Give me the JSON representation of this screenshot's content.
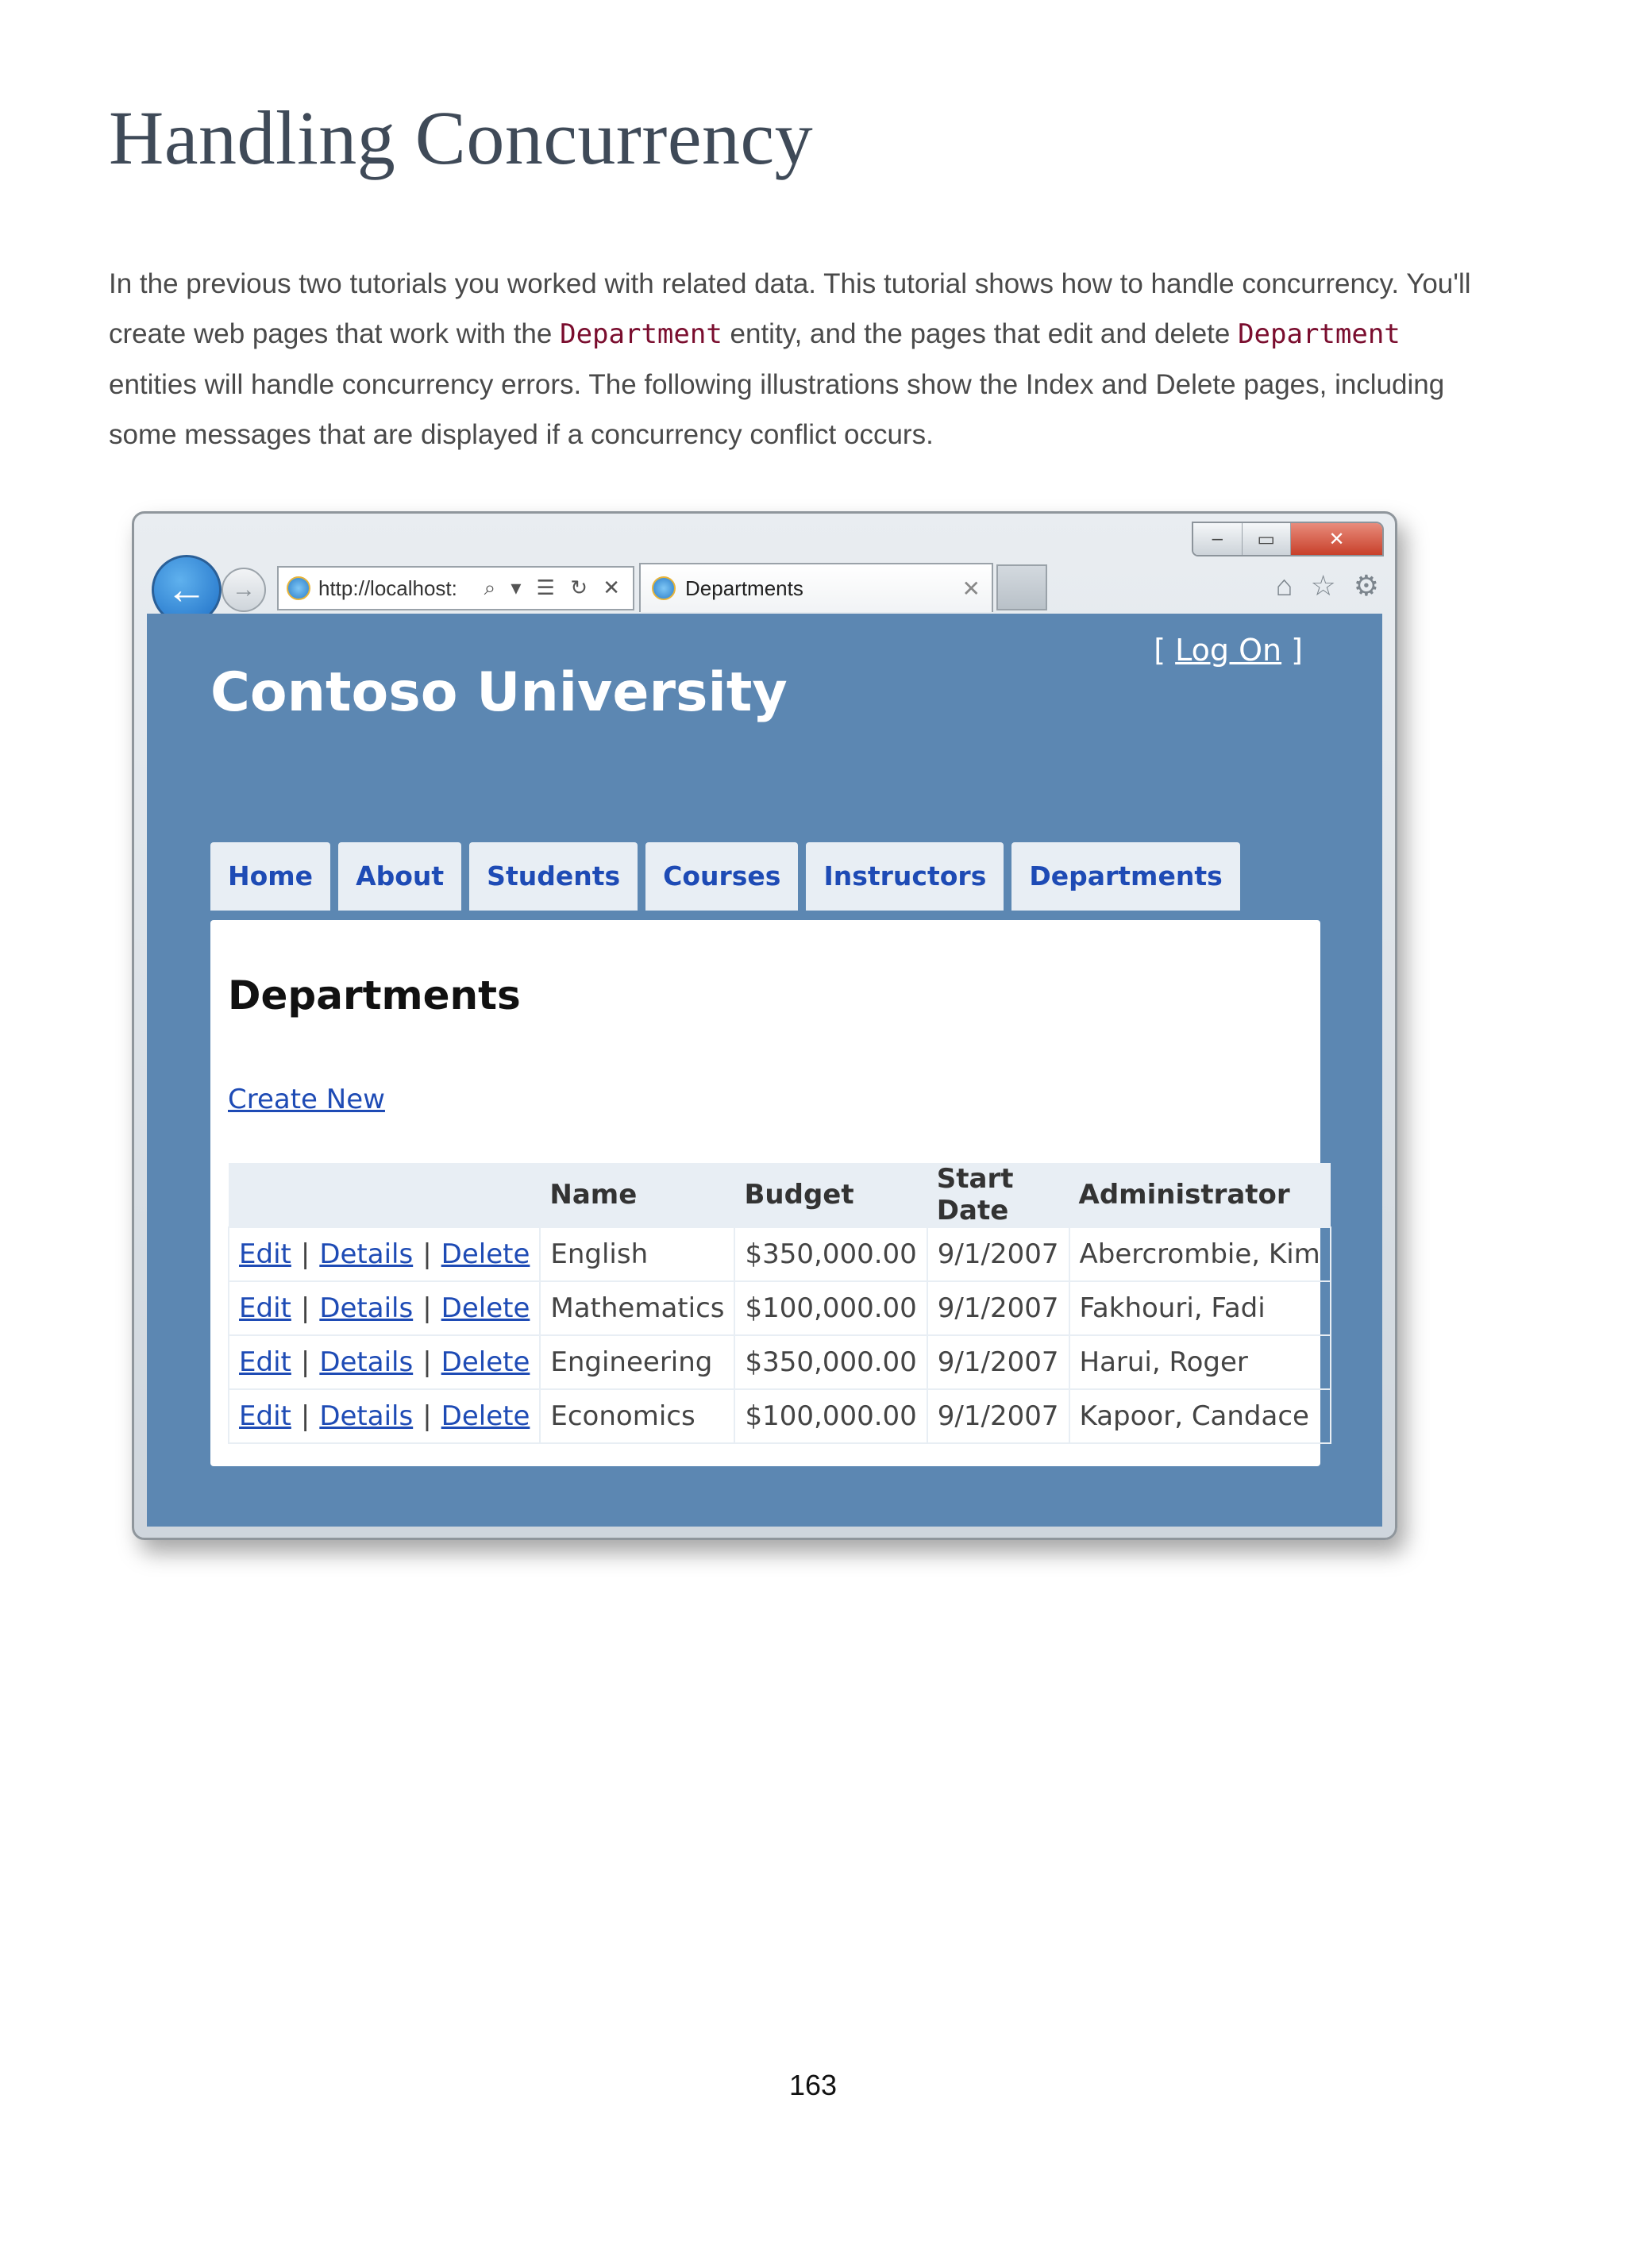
{
  "document": {
    "title": "Handling Concurrency",
    "intro": {
      "part1": "In the previous two tutorials you worked with related data. This tutorial shows how to handle concurrency. You'll create web pages that work with the ",
      "code1": "Department",
      "part2": " entity, and the pages that edit and delete ",
      "code2": "Department",
      "part3": " entities will handle concurrency errors. The following illustrations show the Index and Delete pages, including some messages that are displayed if a concurrency conflict occurs."
    },
    "page_number": "163"
  },
  "browser": {
    "address": "http://localhost:",
    "address_icons": "⌕ ▾ ☰ ↻ ✕",
    "tab_title": "Departments",
    "tab_close": "✕",
    "window_controls": {
      "minimize": "–",
      "maximize": "▭",
      "close": "✕"
    },
    "back": "←",
    "forward": "→",
    "toolbar_icons": {
      "home": "⌂",
      "favorites": "☆",
      "tools": "⚙"
    }
  },
  "site": {
    "login_prefix": "[ ",
    "login_label": "Log On",
    "login_suffix": " ]",
    "title": "Contoso University",
    "menu": [
      "Home",
      "About",
      "Students",
      "Courses",
      "Instructors",
      "Departments"
    ],
    "heading": "Departments",
    "create_new": "Create New",
    "table": {
      "headers": [
        "",
        "Name",
        "Budget",
        "Start Date",
        "Administrator"
      ],
      "action_labels": {
        "edit": "Edit",
        "details": "Details",
        "delete": "Delete",
        "separator": "|"
      },
      "rows": [
        {
          "name": "English",
          "budget": "$350,000.00",
          "start_date": "9/1/2007",
          "administrator": "Abercrombie, Kim"
        },
        {
          "name": "Mathematics",
          "budget": "$100,000.00",
          "start_date": "9/1/2007",
          "administrator": "Fakhouri, Fadi"
        },
        {
          "name": "Engineering",
          "budget": "$350,000.00",
          "start_date": "9/1/2007",
          "administrator": "Harui, Roger"
        },
        {
          "name": "Economics",
          "budget": "$100,000.00",
          "start_date": "9/1/2007",
          "administrator": "Kapoor, Candace"
        }
      ]
    }
  }
}
